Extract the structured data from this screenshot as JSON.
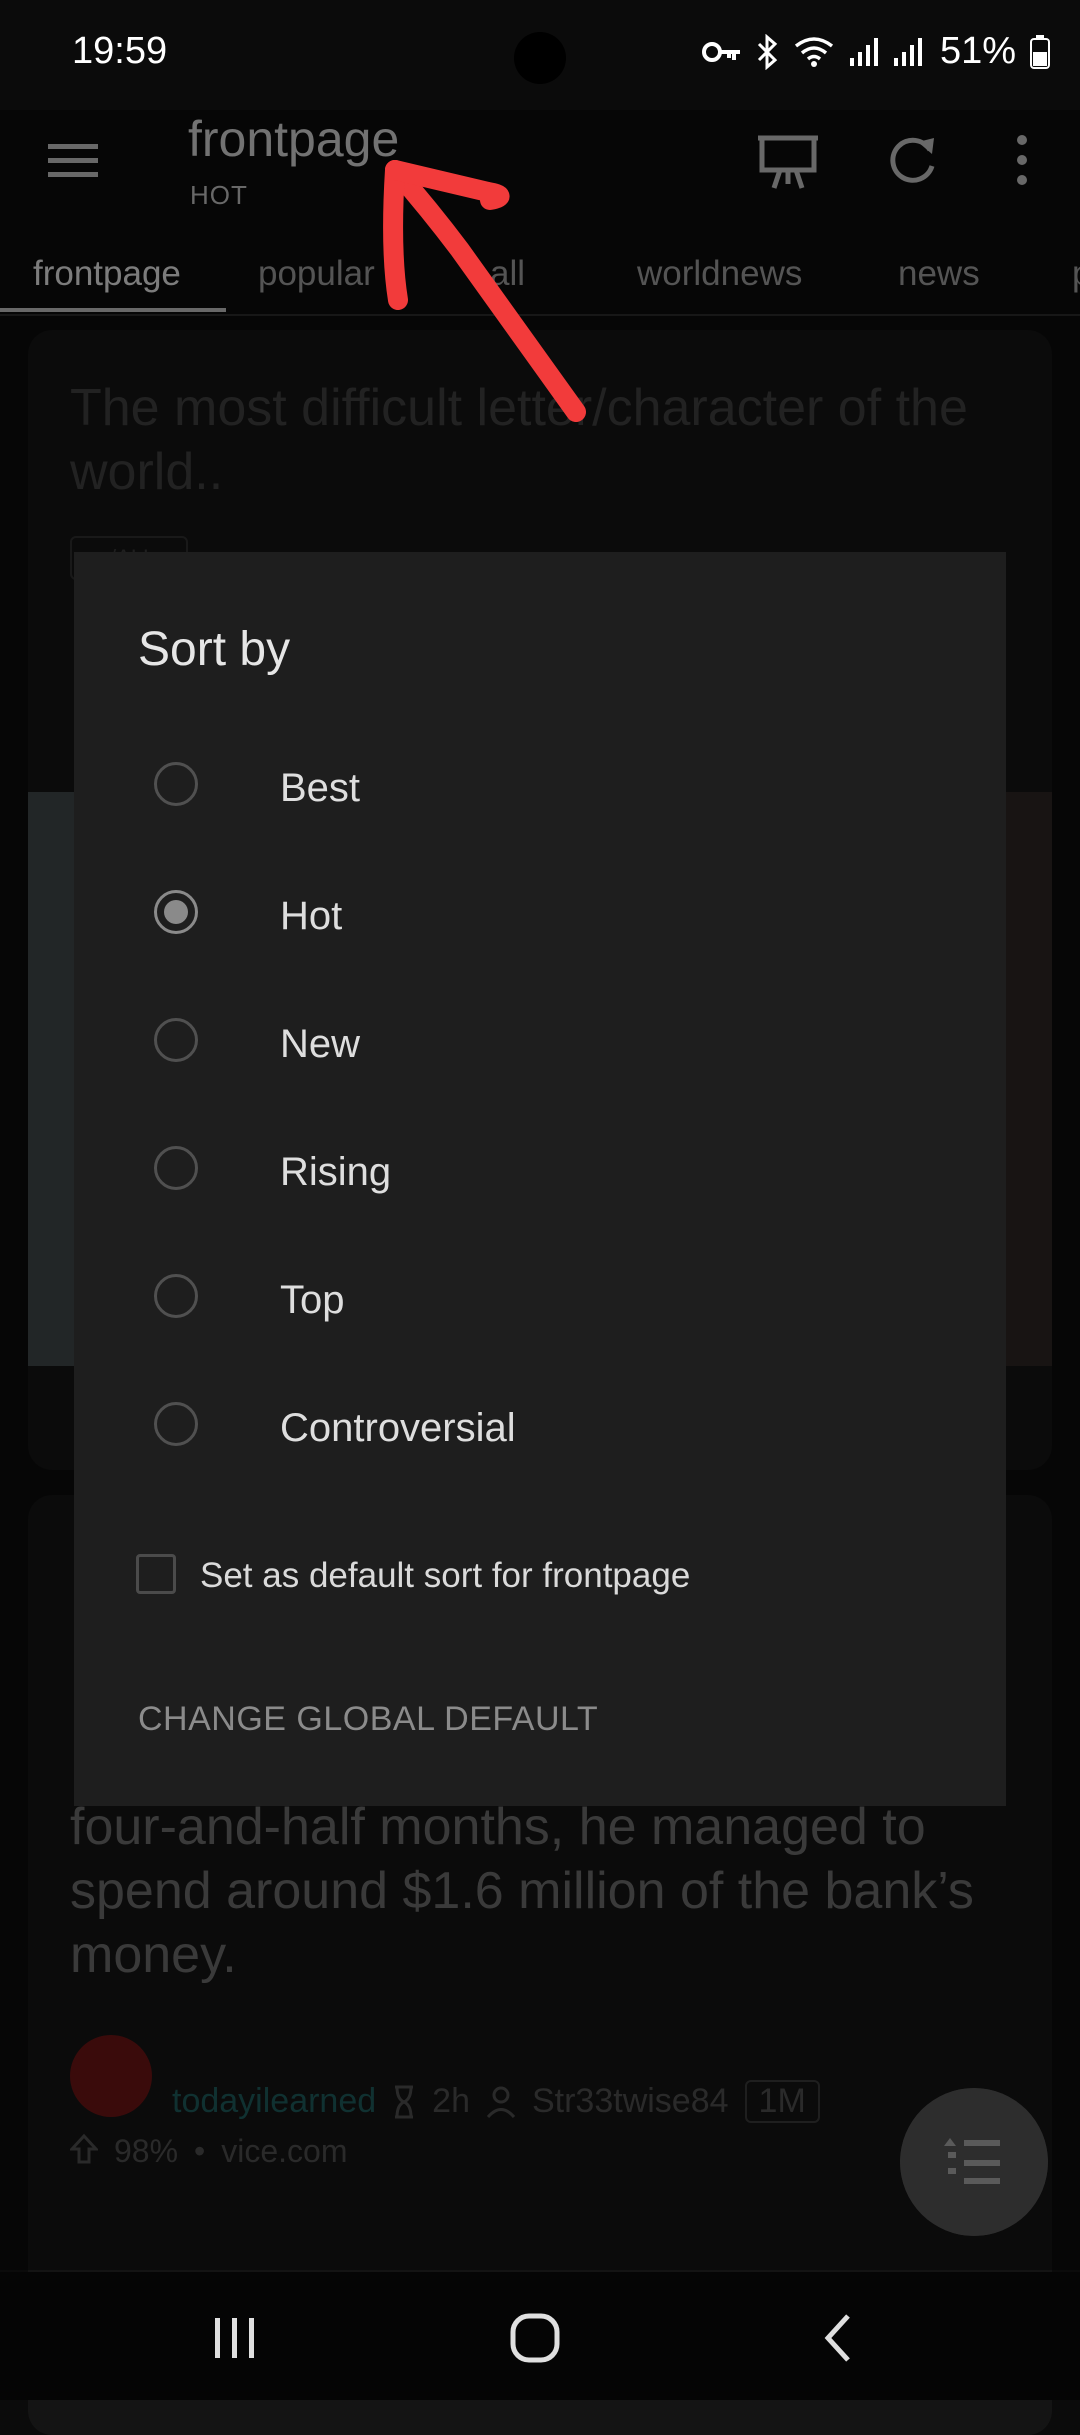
{
  "status_bar": {
    "time": "19:59",
    "battery": "51%"
  },
  "app_bar": {
    "title": "frontpage",
    "subtitle": "HOT",
    "icons": [
      "menu-icon",
      "slideshow-icon",
      "refresh-icon",
      "more-vert-icon"
    ]
  },
  "tabs": [
    {
      "label": "frontpage",
      "active": true
    },
    {
      "label": "popular"
    },
    {
      "label": "all"
    },
    {
      "label": "worldnews"
    },
    {
      "label": "news"
    },
    {
      "label": "p"
    }
  ],
  "feed": {
    "post1": {
      "title": "The most difficult letter/character of the world..",
      "flair": "r/ALL"
    },
    "post2": {
      "title": "four-and-half months, he managed to spend around $1.6 million of the bank’s money.",
      "subreddit": "todayilearned",
      "age": "2h",
      "author": "Str33twise84",
      "award": "1M",
      "upvote_ratio": "98%",
      "domain": "vice.com"
    }
  },
  "dialog": {
    "title": "Sort by",
    "options": [
      {
        "label": "Best",
        "selected": false
      },
      {
        "label": "Hot",
        "selected": true
      },
      {
        "label": "New",
        "selected": false
      },
      {
        "label": "Rising",
        "selected": false
      },
      {
        "label": "Top",
        "selected": false
      },
      {
        "label": "Controversial",
        "selected": false
      }
    ],
    "default_checkbox_label": "Set as default sort for frontpage",
    "default_checked": false,
    "change_global_label": "CHANGE GLOBAL DEFAULT"
  },
  "colors": {
    "annotation": "#f23b3b",
    "background": "#0b0b0b",
    "dialog": "#1e1e1e"
  }
}
